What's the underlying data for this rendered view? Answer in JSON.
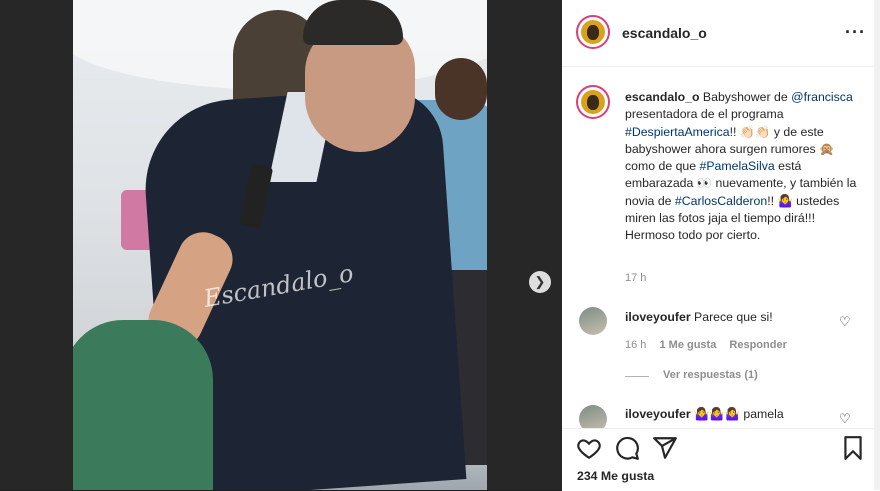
{
  "post": {
    "username": "escandalo_o",
    "more_icon": "more-options-icon"
  },
  "media": {
    "watermark": "Escandalo_o",
    "next_icon": "chevron-right-icon"
  },
  "caption": {
    "username": "escandalo_o",
    "t1": " Babyshower de ",
    "mention": "@francisca",
    "t2": " presentadora de el programa ",
    "tag1": "#DespiertaAmerica",
    "t3": "!! 👏🏻👏🏻 y de este babyshower ahora surgen rumores 🙊 como de que ",
    "tag2": "#PamelaSilva",
    "t4": " está embarazada 👀 nuevamente, y también la novia de ",
    "tag3": "#CarlosCalderon",
    "t5": "!! 🤷‍♀️ ustedes miren las fotos jaja el tiempo dirá!!! Hermoso todo por cierto.",
    "time": "17 h"
  },
  "comments": [
    {
      "username": "iloveyoufer",
      "text": "Parece que si!",
      "time": "16 h",
      "likes": "1 Me gusta",
      "reply": "Responder",
      "view_replies": "Ver respuestas (1)"
    },
    {
      "username": "iloveyoufer",
      "text": "🤷‍♀️🤷‍♀️🤷‍♀️ pamela"
    }
  ],
  "actions": {
    "like_icon": "heart-icon",
    "comment_icon": "comment-icon",
    "share_icon": "share-icon",
    "save_icon": "bookmark-icon",
    "likes": "234 Me gusta"
  }
}
